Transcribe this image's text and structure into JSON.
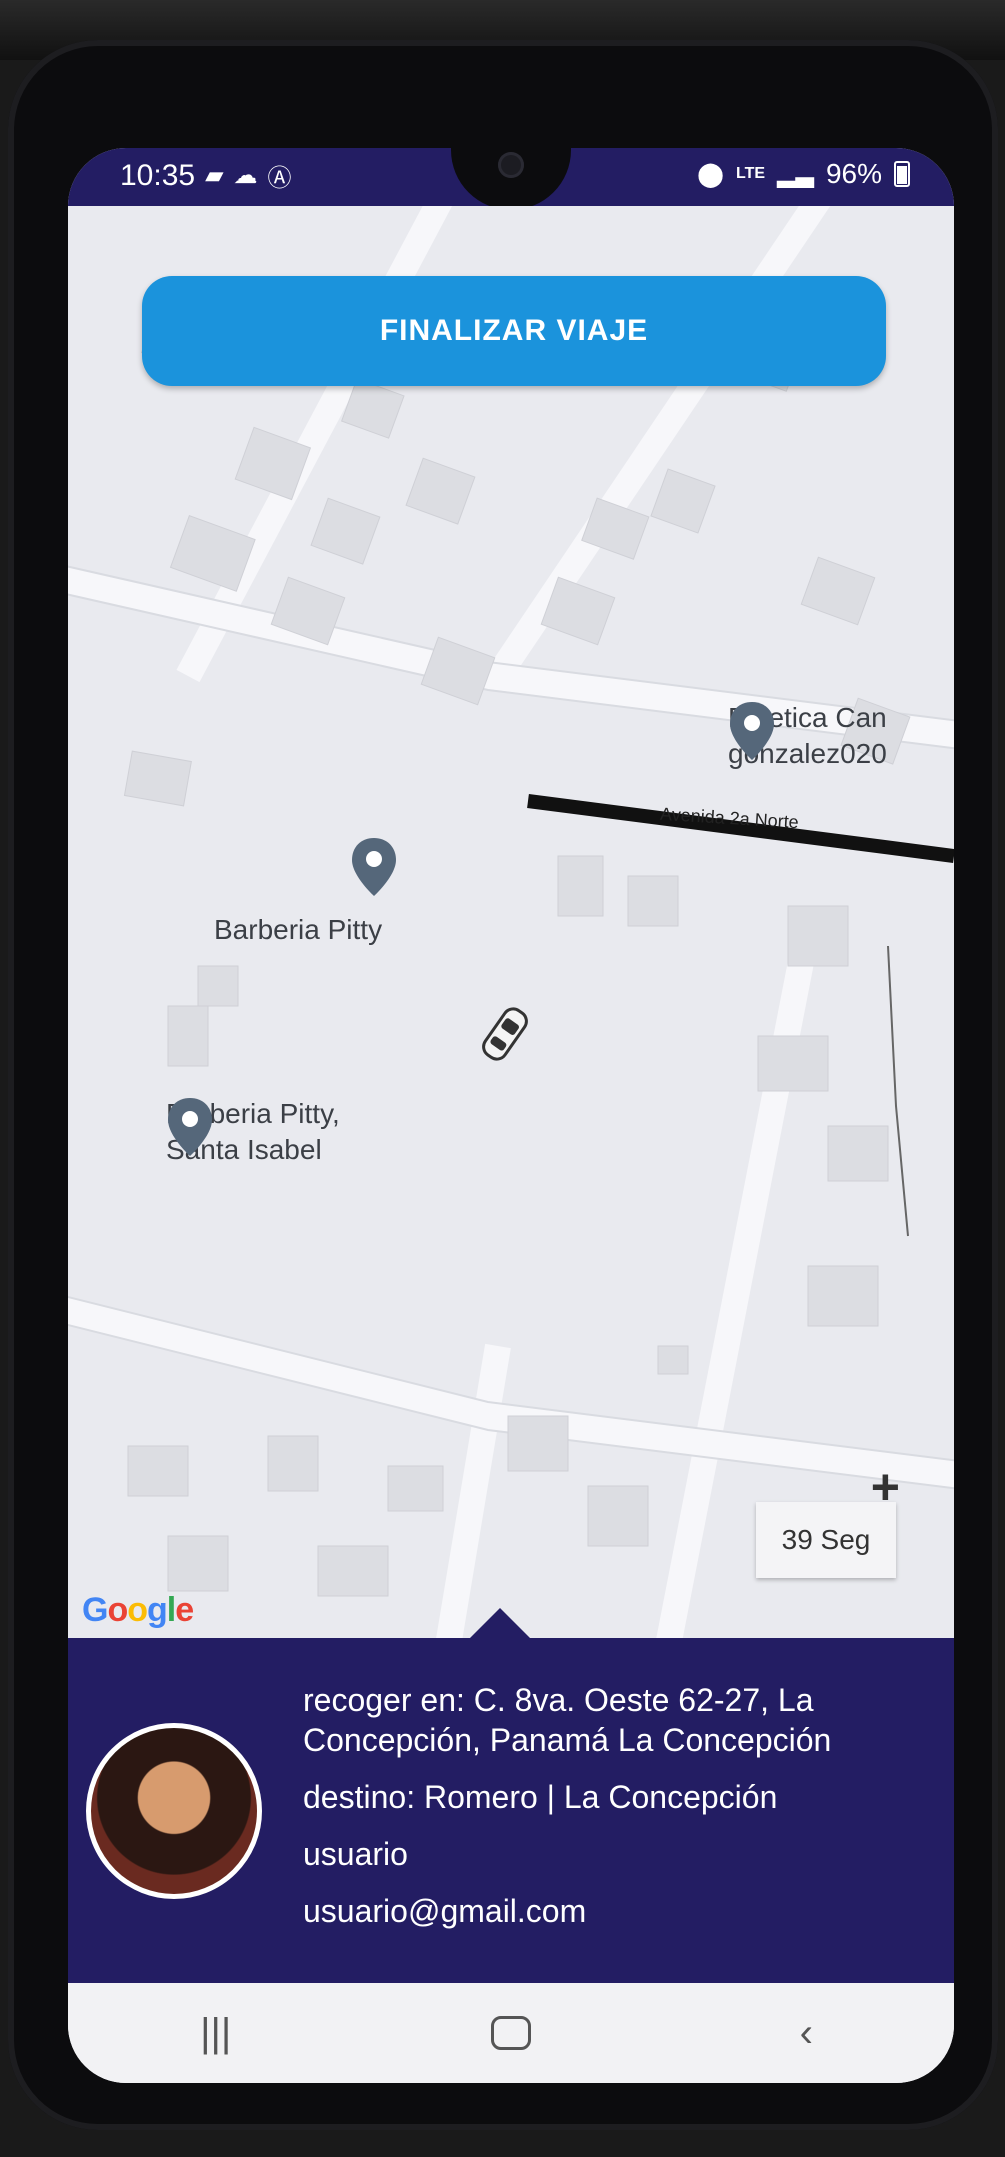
{
  "status_bar": {
    "time": "10:35",
    "battery": "96%",
    "network": "LTE",
    "left_icons": [
      "message-icon",
      "cloud-icon",
      "a-icon"
    ],
    "right_icons": [
      "location-icon",
      "signal-icon",
      "battery-icon"
    ]
  },
  "map": {
    "finish_button": "FINALIZAR VIAJE",
    "pois": [
      {
        "label": "Estetica Can"
      },
      {
        "label": "gonzalez020"
      },
      {
        "label": "Barberia Pitty"
      },
      {
        "label": "Barberia Pitty,"
      },
      {
        "label": "Santa Isabel"
      }
    ],
    "street": "Avenida 2a Norte",
    "zoom_in": "+",
    "timer": "39 Seg",
    "google_logo": "Google",
    "google_colors": [
      "#4285F4",
      "#EA4335",
      "#FBBC05",
      "#4285F4",
      "#34A853",
      "#EA4335"
    ]
  },
  "trip": {
    "pickup_line1": "recoger en: C. 8va. Oeste 62-27, La",
    "pickup_line2": "Concepción, Panamá La Concepción",
    "destination": "destino: Romero | La Concepción",
    "user_name": "usuario",
    "user_email": "usuario@gmail.com"
  },
  "navbar": {
    "recents": "|||",
    "back": "‹"
  },
  "colors": {
    "accent": "#1b93dc",
    "sheet": "#231d63",
    "map_bg": "#e9eaef"
  }
}
